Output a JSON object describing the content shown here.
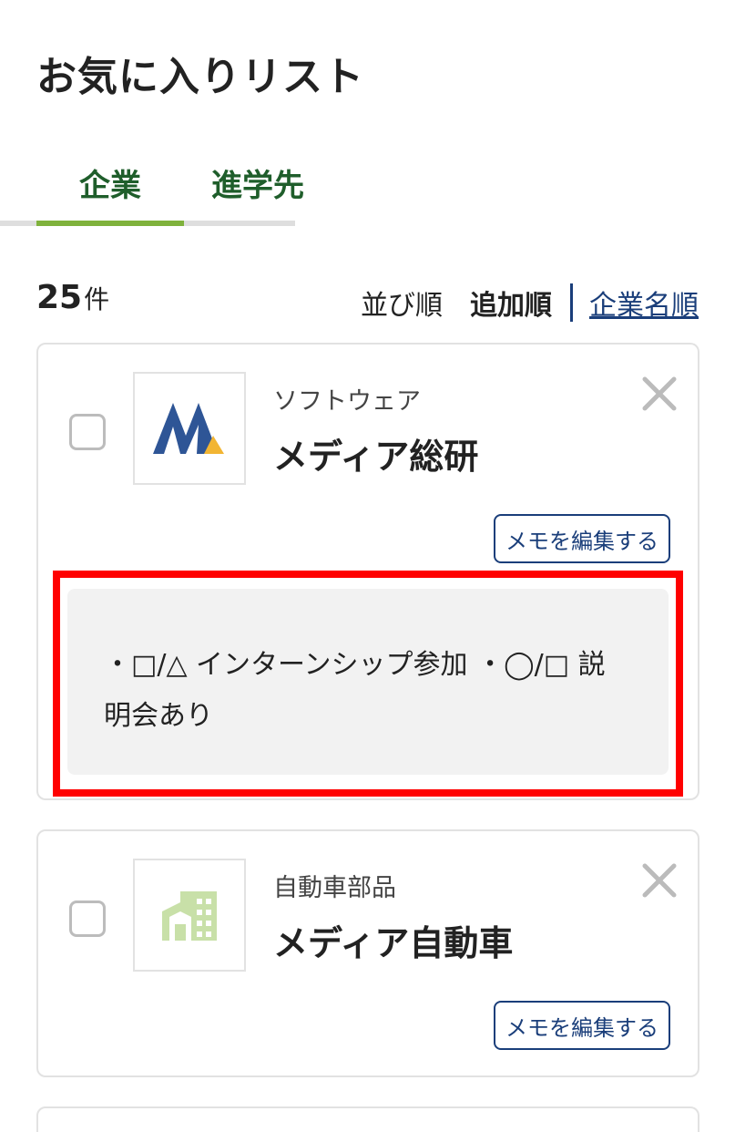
{
  "page": {
    "title": "お気に入りリスト"
  },
  "tabs": [
    {
      "label": "企業",
      "active": true
    },
    {
      "label": "進学先",
      "active": false
    }
  ],
  "results": {
    "count": "25",
    "unit": "件"
  },
  "sort": {
    "label": "並び順",
    "options": [
      "追加順",
      "企業名順"
    ],
    "selected": "追加順"
  },
  "colors": {
    "accent_green": "#7fb23c",
    "tab_text": "#1f5e2b",
    "link_navy": "#1a3e7a",
    "highlight_red": "#ff0000",
    "memo_bg": "#f2f2f2"
  },
  "cards": [
    {
      "industry": "ソフトウェア",
      "name": "メディア総研",
      "logo": "company-m-logo",
      "memo_button_label": "メモを編集する",
      "memo": "・□/△ インターンシップ参加 ・◯/□ 説明会あり",
      "checked": false
    },
    {
      "industry": "自動車部品",
      "name": "メディア自動車",
      "logo": "building-placeholder-icon",
      "memo_button_label": "メモを編集する",
      "checked": false
    }
  ],
  "icons": {
    "remove": "close-icon",
    "checkbox": "checkbox-icon"
  }
}
